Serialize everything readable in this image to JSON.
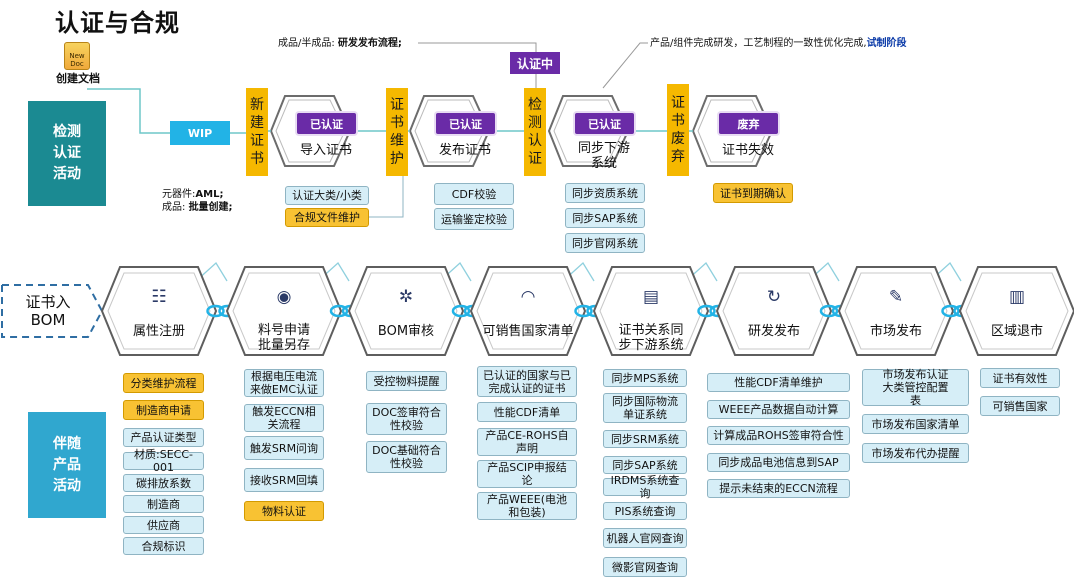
{
  "title": "认证与合规",
  "create_doc": {
    "icon_text": "New Doc",
    "label": "创建文档"
  },
  "sidebar": {
    "detect": "检测\n认证\n活动",
    "accompany": "伴随\n产品\n活动"
  },
  "wip": "WIP",
  "cert_in": "证书入\nBOM",
  "top_notes": {
    "left_prefix": "成品/半成品: ",
    "left_bold": "研发发布流程;",
    "right_prefix": "产品/组件完成研发，工艺制程的一致性优化完成,",
    "right_bold": "试制阶段",
    "status_box": "认证中",
    "bottom_l1_prefix": "元器件:",
    "bottom_l1_bold": "AML;",
    "bottom_l2_prefix": "成品: ",
    "bottom_l2_bold": "批量创建;"
  },
  "top_flow": {
    "v1": "新建证书",
    "v2": "证书维护",
    "v3": "检测认证",
    "v4": "证书废弃",
    "hex1": {
      "badge": "已认证",
      "label": "导入证书"
    },
    "hex2": {
      "badge": "已认证",
      "label": "发布证书"
    },
    "hex3": {
      "badge": "已认证",
      "label": "同步下游\n系统"
    },
    "hex4": {
      "badge": "废弃",
      "label": "证书失效"
    }
  },
  "top_tags": {
    "col1": [
      {
        "t": "认证大类/小类",
        "y": false
      },
      {
        "t": "合规文件维护",
        "y": true
      }
    ],
    "col2": [
      {
        "t": "CDF校验",
        "y": false
      },
      {
        "t": "运输鉴定校验",
        "y": false
      }
    ],
    "col3": [
      {
        "t": "同步资质系统",
        "y": false
      },
      {
        "t": "同步SAP系统",
        "y": false
      },
      {
        "t": "同步官网系统",
        "y": false
      }
    ],
    "col4": [
      {
        "t": "证书到期确认",
        "y": true
      }
    ]
  },
  "nodes": [
    {
      "icon": "☷",
      "icon_name": "list-icon",
      "label": "属性注册"
    },
    {
      "icon": "◉",
      "icon_name": "eye-icon",
      "label": "料号申请\n批量另存"
    },
    {
      "icon": "✲",
      "icon_name": "gears-icon",
      "label": "BOM审核"
    },
    {
      "icon": "◠",
      "icon_name": "gauge-icon",
      "label": "可销售国家清单"
    },
    {
      "icon": "▤",
      "icon_name": "document-icon",
      "label": "证书关系同\n步下游系统"
    },
    {
      "icon": "↻",
      "icon_name": "clock-refresh-icon",
      "label": "研发发布"
    },
    {
      "icon": "✎",
      "icon_name": "wrench-icon",
      "label": "市场发布"
    },
    {
      "icon": "▥",
      "icon_name": "factory-icon",
      "label": "区域退市"
    }
  ],
  "bottom_tags": {
    "c1": [
      {
        "t": "分类维护流程",
        "y": true
      },
      {
        "t": "制造商申请",
        "y": true
      },
      {
        "t": "产品认证类型",
        "y": false
      },
      {
        "t": "材质:SECC-001",
        "y": false
      },
      {
        "t": "碳排放系数",
        "y": false
      },
      {
        "t": "制造商",
        "y": false
      },
      {
        "t": "供应商",
        "y": false
      },
      {
        "t": "合规标识",
        "y": false
      }
    ],
    "c2": [
      {
        "t": "根据电压电流\n来做EMC认证",
        "y": false
      },
      {
        "t": "触发ECCN相\n关流程",
        "y": false
      },
      {
        "t": "触发SRM问询",
        "y": false
      },
      {
        "t": "接收SRM回填",
        "y": false
      },
      {
        "t": "物料认证",
        "y": true
      }
    ],
    "c3": [
      {
        "t": "受控物料提醒",
        "y": false
      },
      {
        "t": "DOC签审符合\n性校验",
        "y": false
      },
      {
        "t": "DOC基础符合\n性校验",
        "y": false
      }
    ],
    "c4": [
      {
        "t": "已认证的国家与已\n完成认证的证书",
        "y": false
      },
      {
        "t": "性能CDF清单",
        "y": false
      },
      {
        "t": "产品CE-ROHS自\n声明",
        "y": false
      },
      {
        "t": "产品SCIP申报结\n论",
        "y": false
      },
      {
        "t": "产品WEEE(电池\n和包装)",
        "y": false
      }
    ],
    "c5": [
      {
        "t": "同步MPS系统",
        "y": false
      },
      {
        "t": "同步国际物流\n单证系统",
        "y": false
      },
      {
        "t": "同步SRM系统",
        "y": false
      },
      {
        "t": "同步SAP系统",
        "y": false
      },
      {
        "t": "IRDMS系统查询",
        "y": false
      },
      {
        "t": "PIS系统查询",
        "y": false
      },
      {
        "t": "机器人官网查询",
        "y": false
      },
      {
        "t": "微影官网查询",
        "y": false
      }
    ],
    "c6": [
      {
        "t": "性能CDF清单维护",
        "y": false
      },
      {
        "t": "WEEE产品数据自动计算",
        "y": false
      },
      {
        "t": "计算成品ROHS签审符合性",
        "y": false
      },
      {
        "t": "同步成品电池信息到SAP",
        "y": false
      },
      {
        "t": "提示未结束的ECCN流程",
        "y": false
      }
    ],
    "c7": [
      {
        "t": "市场发布认证\n大类管控配置\n表",
        "y": false
      },
      {
        "t": "市场发布国家清单",
        "y": false
      },
      {
        "t": "市场发布代办提醒",
        "y": false
      }
    ],
    "c8": [
      {
        "t": "证书有效性",
        "y": false
      },
      {
        "t": "可销售国家",
        "y": false
      }
    ]
  },
  "colors": {
    "teal": "#1b8a92",
    "blue": "#30a7cf",
    "yellow": "#f5b800",
    "purple": "#6a2ba7",
    "tag": "#d6eef7",
    "link": "#22b3e6"
  }
}
